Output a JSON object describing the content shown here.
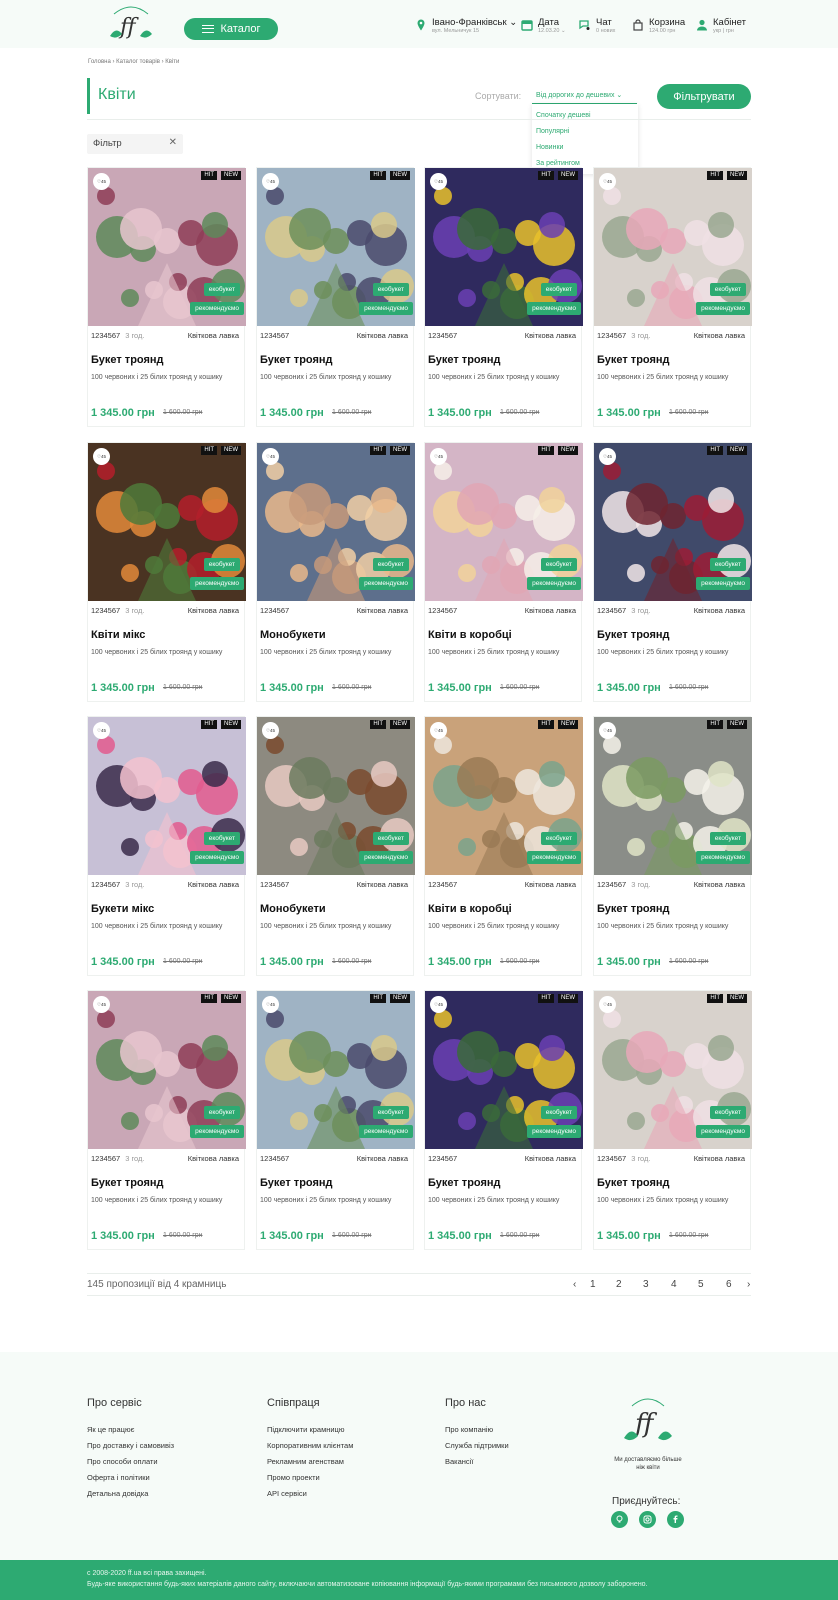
{
  "header": {
    "catalog_label": "Каталог",
    "city": "Івано-Франківськ",
    "address": "вул. Мельничук 15",
    "date_label": "Дата",
    "date_value": "12.03.20",
    "chat_label": "Чат",
    "chat_sub": "0 нових",
    "cart_label": "Корзина",
    "cart_sub": "124.00 грн",
    "account_label": "Кабінет",
    "account_sub": "укр | грн"
  },
  "breadcrumb": "Головна › Каталог товарів › Квіти",
  "page_title": "Квіти",
  "sort": {
    "label": "Сортувати:",
    "selected": "Від дорогих до дешевих",
    "options": [
      "Спочатку дешеві",
      "Популярні",
      "Новинки",
      "За рейтингом"
    ]
  },
  "filter_button": "Фільтрувати",
  "active_filter": "Фільтр",
  "products": [
    {
      "name": "Букет троянд",
      "code": "1234567",
      "age": "3 год.",
      "shop": "Квіткова лавка",
      "desc": "100 червоних і 25 білих троянд у кошику",
      "price": "1 345.00 грн",
      "old_price": "1 600.00 грн",
      "favs": "45",
      "hit": "HIT",
      "new": "NEW",
      "eco": "екобукет",
      "rec": "рекомендуємо"
    },
    {
      "name": "Букет троянд",
      "code": "1234567",
      "age": "",
      "shop": "Квіткова лавка",
      "desc": "100 червоних і 25 білих троянд у кошику",
      "price": "1 345.00 грн",
      "old_price": "1 600.00 грн",
      "favs": "45",
      "hit": "HIT",
      "new": "NEW",
      "eco": "екобукет",
      "rec": "рекомендуємо"
    },
    {
      "name": "Букет троянд",
      "code": "1234567",
      "age": "",
      "shop": "Квіткова лавка",
      "desc": "100 червоних і 25 білих троянд у кошику",
      "price": "1 345.00 грн",
      "old_price": "1 600.00 грн",
      "favs": "45",
      "hit": "HIT",
      "new": "NEW",
      "eco": "екобукет",
      "rec": "рекомендуємо"
    },
    {
      "name": "Букет троянд",
      "code": "1234567",
      "age": "3 год.",
      "shop": "Квіткова лавка",
      "desc": "100 червоних і 25 білих троянд у кошику",
      "price": "1 345.00 грн",
      "old_price": "1 600.00 грн",
      "favs": "45",
      "hit": "HIT",
      "new": "NEW",
      "eco": "екобукет",
      "rec": "рекомендуємо"
    },
    {
      "name": "Квіти мікс",
      "code": "1234567",
      "age": "3 год.",
      "shop": "Квіткова лавка",
      "desc": "100 червоних і 25 білих троянд у кошику",
      "price": "1 345.00 грн",
      "old_price": "1 600.00 грн",
      "favs": "45",
      "hit": "HIT",
      "new": "NEW",
      "eco": "екобукет",
      "rec": "рекомендуємо"
    },
    {
      "name": "Монобукети",
      "code": "1234567",
      "age": "",
      "shop": "Квіткова лавка",
      "desc": "100 червоних і 25 білих троянд у кошику",
      "price": "1 345.00 грн",
      "old_price": "1 600.00 грн",
      "favs": "45",
      "hit": "HIT",
      "new": "NEW",
      "eco": "екобукет",
      "rec": "рекомендуємо"
    },
    {
      "name": "Квіти в коробці",
      "code": "1234567",
      "age": "",
      "shop": "Квіткова лавка",
      "desc": "100 червоних і 25 білих троянд у кошику",
      "price": "1 345.00 грн",
      "old_price": "1 600.00 грн",
      "favs": "45",
      "hit": "HIT",
      "new": "NEW",
      "eco": "екобукет",
      "rec": "рекомендуємо"
    },
    {
      "name": "Букет троянд",
      "code": "1234567",
      "age": "3 год.",
      "shop": "Квіткова лавка",
      "desc": "100 червоних і 25 білих троянд у кошику",
      "price": "1 345.00 грн",
      "old_price": "1 600.00 грн",
      "favs": "45",
      "hit": "HIT",
      "new": "NEW",
      "eco": "екобукет",
      "rec": "рекомендуємо"
    },
    {
      "name": "Букети мікс",
      "code": "1234567",
      "age": "3 год.",
      "shop": "Квіткова лавка",
      "desc": "100 червоних і 25 білих троянд у кошику",
      "price": "1 345.00 грн",
      "old_price": "1 600.00 грн",
      "favs": "45",
      "hit": "HIT",
      "new": "NEW",
      "eco": "екобукет",
      "rec": "рекомендуємо"
    },
    {
      "name": "Монобукети",
      "code": "1234567",
      "age": "",
      "shop": "Квіткова лавка",
      "desc": "100 червоних і 25 білих троянд у кошику",
      "price": "1 345.00 грн",
      "old_price": "1 600.00 грн",
      "favs": "45",
      "hit": "HIT",
      "new": "NEW",
      "eco": "екобукет",
      "rec": "рекомендуємо"
    },
    {
      "name": "Квіти в коробці",
      "code": "1234567",
      "age": "",
      "shop": "Квіткова лавка",
      "desc": "100 червоних і 25 білих троянд у кошику",
      "price": "1 345.00 грн",
      "old_price": "1 600.00 грн",
      "favs": "45",
      "hit": "HIT",
      "new": "NEW",
      "eco": "екобукет",
      "rec": "рекомендуємо"
    },
    {
      "name": "Букет троянд",
      "code": "1234567",
      "age": "3 год.",
      "shop": "Квіткова лавка",
      "desc": "100 червоних і 25 білих троянд у кошику",
      "price": "1 345.00 грн",
      "old_price": "1 600.00 грн",
      "favs": "45",
      "hit": "HIT",
      "new": "NEW",
      "eco": "екобукет",
      "rec": "рекомендуємо"
    },
    {
      "name": "Букет троянд",
      "code": "1234567",
      "age": "3 год.",
      "shop": "Квіткова лавка",
      "desc": "100 червоних і 25 білих троянд у кошику",
      "price": "1 345.00 грн",
      "old_price": "1 600.00 грн",
      "favs": "45",
      "hit": "HIT",
      "new": "NEW",
      "eco": "екобукет",
      "rec": "рекомендуємо"
    },
    {
      "name": "Букет троянд",
      "code": "1234567",
      "age": "",
      "shop": "Квіткова лавка",
      "desc": "100 червоних і 25 білих троянд у кошику",
      "price": "1 345.00 грн",
      "old_price": "1 600.00 грн",
      "favs": "45",
      "hit": "HIT",
      "new": "NEW",
      "eco": "екобукет",
      "rec": "рекомендуємо"
    },
    {
      "name": "Букет троянд",
      "code": "1234567",
      "age": "",
      "shop": "Квіткова лавка",
      "desc": "100 червоних і 25 білих троянд у кошику",
      "price": "1 345.00 грн",
      "old_price": "1 600.00 грн",
      "favs": "45",
      "hit": "HIT",
      "new": "NEW",
      "eco": "екобукет",
      "rec": "рекомендуємо"
    },
    {
      "name": "Букет троянд",
      "code": "1234567",
      "age": "3 год.",
      "shop": "Квіткова лавка",
      "desc": "100 червоних і 25 білих троянд у кошику",
      "price": "1 345.00 грн",
      "old_price": "1 600.00 грн",
      "favs": "45",
      "hit": "HIT",
      "new": "NEW",
      "eco": "екобукет",
      "rec": "рекомендуємо"
    }
  ],
  "summary": "145 пропозиції від 4 крамниць",
  "pagination": {
    "prev": "‹",
    "pages": [
      "1",
      "2",
      "3",
      "4",
      "5",
      "6"
    ],
    "next": "›"
  },
  "footer": {
    "col1_title": "Про сервіс",
    "col1_links": [
      "Як це працює",
      "Про доставку і самовивіз",
      "Про способи оплати",
      "Оферта і політики",
      "Детальна довідка"
    ],
    "col2_title": "Співпраця",
    "col2_links": [
      "Підключити крамницю",
      "Корпоративним клієнтам",
      "Рекламним агенствам",
      "Промо проекти",
      "API сервіси"
    ],
    "col3_title": "Про нас",
    "col3_links": [
      "Про компанію",
      "Служба підтримки",
      "Вакансії"
    ],
    "tagline": "Ми доставляємо більше ніж квіти",
    "join": "Приєднуйтесь:",
    "copyright": "с 2008-2020 ff.ua всі права захищені.",
    "legal": "Будь-яке використання будь-яких матеріалів даного сайту, включаючи автоматизоване копіювання інформації будь-якими програмами без письмового дозволу заборонено."
  },
  "colors": {
    "accent": "#2daa72",
    "header_bg": "#f6fbf8"
  }
}
